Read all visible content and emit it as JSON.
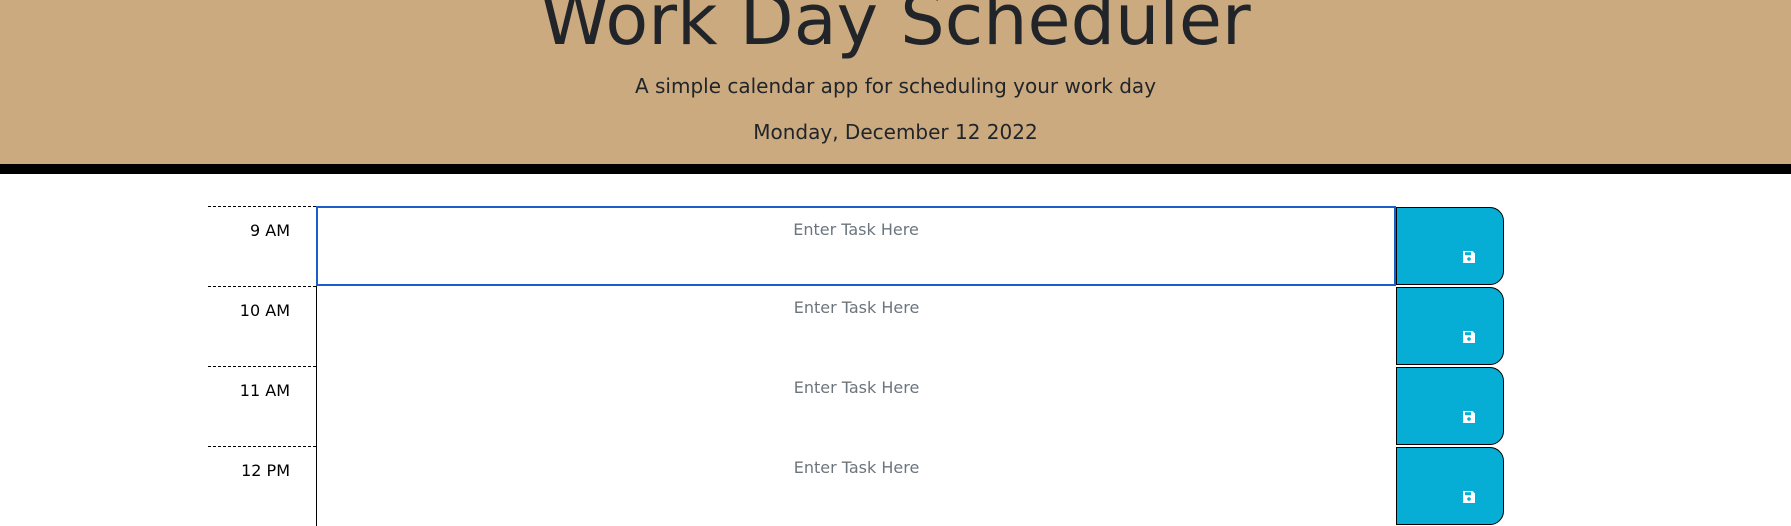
{
  "header": {
    "title": "Work Day Scheduler",
    "subtitle": "A simple calendar app for scheduling your work day",
    "current_day": "Monday, December 12 2022"
  },
  "time_blocks": [
    {
      "hour": "9 AM",
      "placeholder": "Enter Task Here",
      "save_icon": "floppy-disk-icon"
    },
    {
      "hour": "10 AM",
      "placeholder": "Enter Task Here",
      "save_icon": "floppy-disk-icon"
    },
    {
      "hour": "11 AM",
      "placeholder": "Enter Task Here",
      "save_icon": "floppy-disk-icon"
    },
    {
      "hour": "12 PM",
      "placeholder": "Enter Task Here",
      "save_icon": "floppy-disk-icon"
    }
  ],
  "colors": {
    "header_background": "#cbaa80",
    "save_button": "#06aed5",
    "focus_border": "#1a5fc8"
  }
}
